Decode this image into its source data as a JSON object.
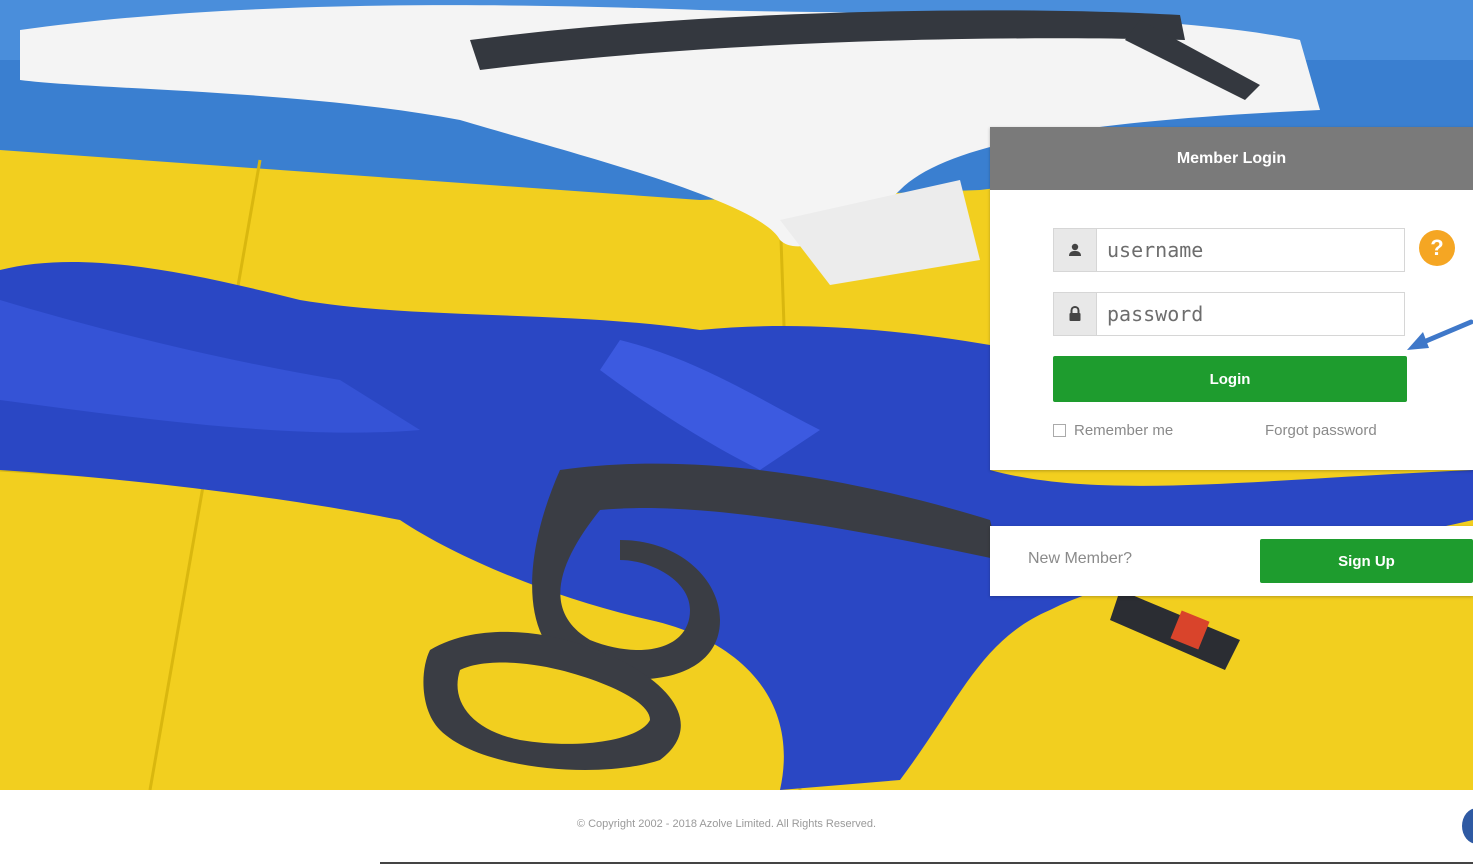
{
  "login": {
    "title": "Member Login",
    "username_placeholder": "username",
    "password_placeholder": "password",
    "login_label": "Login",
    "remember_label": "Remember me",
    "forgot_label": "Forgot password",
    "help_symbol": "?"
  },
  "signup": {
    "prompt": "New Member?",
    "button_label": "Sign Up"
  },
  "footer": {
    "copyright": "© Copyright 2002 - 2018 Azolve Limited. All Rights Reserved."
  },
  "icons": {
    "username": "user-icon",
    "password": "lock-icon",
    "help": "question-icon",
    "annotation": "arrow-left-icon"
  },
  "colors": {
    "header_bg": "#7a7a7a",
    "button_green": "#1e9c2e",
    "help_orange": "#f5a623",
    "mat_yellow": "#f2cf1f",
    "mat_blue": "#3a7fd0",
    "gi_blue": "#2a47c4"
  }
}
